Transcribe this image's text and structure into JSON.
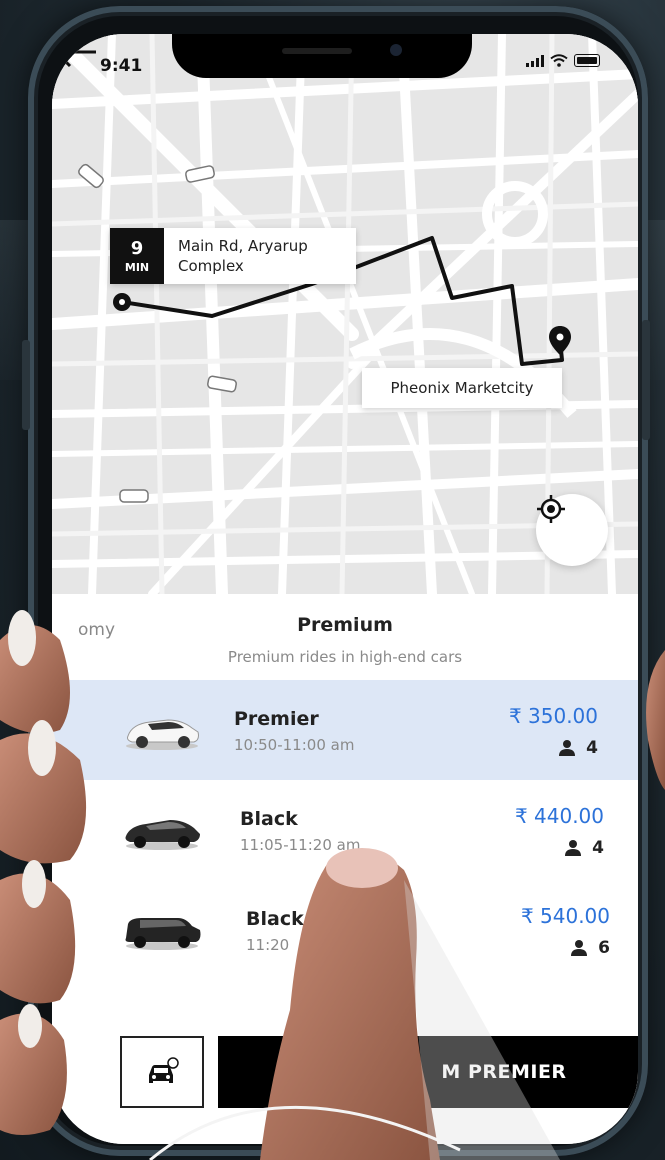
{
  "status_bar": {
    "time": "9:41"
  },
  "map": {
    "eta": {
      "value": "9",
      "unit": "MIN"
    },
    "pickup_address": "Main Rd, Aryarup Complex",
    "destination": "Pheonix Marketcity"
  },
  "category": {
    "previous_label": "omy",
    "title": "Premium",
    "subtitle": "Premium rides in high-end cars"
  },
  "rides": [
    {
      "name": "Premier",
      "time": "10:50-11:00 am",
      "price": "₹ 350.00",
      "seats": "4",
      "selected": true
    },
    {
      "name": "Black",
      "time": "11:05-11:20 am",
      "price": "₹ 440.00",
      "seats": "4",
      "selected": false
    },
    {
      "name": "Black",
      "time": "11:20",
      "price": "₹ 540.00",
      "seats": "6",
      "selected": false
    }
  ],
  "confirm_button": {
    "label": "M PREMIER"
  },
  "icons": {
    "back": "arrow-left-icon",
    "locate": "crosshair-icon",
    "seat": "person-icon",
    "rider": "taxi-chat-icon"
  },
  "colors": {
    "accent": "#2c72d9",
    "selected_row": "#dde7f6",
    "button": "#000000"
  }
}
